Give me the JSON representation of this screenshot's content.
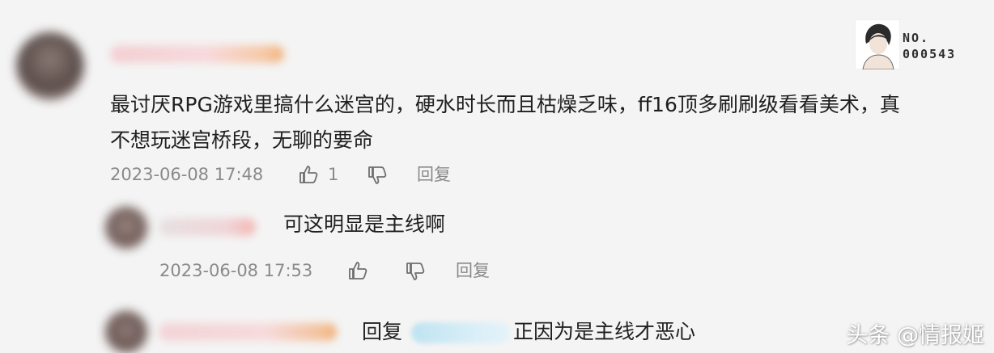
{
  "badge": {
    "line1": "NO.",
    "line2": "000543"
  },
  "main_comment": {
    "text": "最讨厌RPG游戏里搞什么迷宫的，硬水时长而且枯燥乏味，ff16顶多刷刷级看看美术，真\n不想玩迷宫桥段，无聊的要命",
    "timestamp": "2023-06-08 17:48",
    "like_count": "1",
    "reply_label": "回复"
  },
  "reply1": {
    "text": "可这明显是主线啊",
    "timestamp": "2023-06-08 17:53",
    "reply_label": "回复"
  },
  "reply2": {
    "prefix": "回复",
    "text": "正因为是主线才恶心"
  },
  "watermark": "头条 @情报姬",
  "icons": {
    "like": "thumbs-up-icon",
    "dislike": "thumbs-down-icon"
  },
  "colors": {
    "text": "#1f1f1f",
    "meta": "#8a8a8a",
    "mention_blue": "#cbe8f4"
  }
}
